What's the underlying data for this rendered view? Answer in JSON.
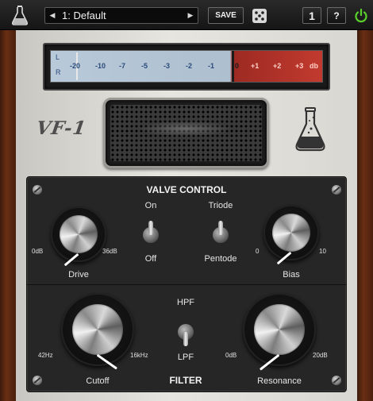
{
  "toolbar": {
    "logo_icon": "flask-icon",
    "preset_name": "1: Default",
    "save_label": "SAVE",
    "randomize_icon": "dice-icon",
    "instance_label": "1",
    "help_label": "?",
    "power_icon": "power-icon"
  },
  "brand": "VF-1",
  "meter": {
    "left_label": "L",
    "right_label": "R",
    "scale": [
      "-20",
      "-10",
      "-7",
      "-5",
      "-3",
      "-2",
      "-1",
      "0",
      "+1",
      "+2",
      "+3",
      "db"
    ]
  },
  "valve_control": {
    "title": "VALVE CONTROL",
    "drive": {
      "label": "Drive",
      "min": "0dB",
      "max": "36dB"
    },
    "on_off": {
      "top": "On",
      "bottom": "Off",
      "state": "On"
    },
    "mode": {
      "top": "Triode",
      "bottom": "Pentode",
      "state": "Triode"
    },
    "bias": {
      "label": "Bias",
      "min": "0",
      "max": "10"
    }
  },
  "filter": {
    "title": "FILTER",
    "cutoff": {
      "label": "Cutoff",
      "min": "42Hz",
      "max": "16kHz"
    },
    "type": {
      "top": "HPF",
      "bottom": "LPF",
      "state": "LPF"
    },
    "resonance": {
      "label": "Resonance",
      "min": "0dB",
      "max": "20dB"
    }
  },
  "colors": {
    "meter_blue": "#aebfd0",
    "meter_red": "#c23a2f",
    "panel_dark": "#262626",
    "wood": "#6a2f14"
  }
}
